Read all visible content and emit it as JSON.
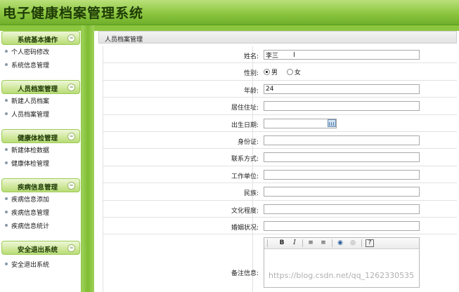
{
  "app": {
    "title": "电子健康档案管理系统"
  },
  "sidebar": {
    "sections": [
      {
        "title": "系统基本操作",
        "items": [
          "个人密码修改",
          "系统信息管理"
        ]
      },
      {
        "title": "人员档案管理",
        "items": [
          "新建人员档案",
          "人员档案管理"
        ]
      },
      {
        "title": "健康体检管理",
        "items": [
          "新建体检数据",
          "健康体检管理"
        ]
      },
      {
        "title": "疾病信息管理",
        "items": [
          "疾病信息添加",
          "疾病信息管理",
          "疾病信息统计"
        ]
      },
      {
        "title": "安全退出系统",
        "items": [
          "安全退出系统"
        ]
      }
    ],
    "collapse_glyph": "≈"
  },
  "main": {
    "panel_title": "人员档案管理",
    "form": {
      "name_label": "姓名:",
      "name_value": "李三",
      "gender_label": "性别:",
      "gender_male": "男",
      "gender_female": "女",
      "gender_selected": "男",
      "age_label": "年龄:",
      "age_value": "24",
      "address_label": "居住住址:",
      "address_value": "",
      "birth_label": "出生日期:",
      "birth_value": "",
      "id_label": "身份证:",
      "id_value": "",
      "contact_label": "联系方式:",
      "contact_value": "",
      "work_label": "工作单位:",
      "work_value": "",
      "ethnic_label": "民族:",
      "ethnic_value": "",
      "edu_label": "文化程度:",
      "edu_value": "",
      "marital_label": "婚姻状况:",
      "marital_value": "",
      "notes_label": "备注信息:"
    },
    "editor_toolbar": {
      "bold": "B",
      "italic": "I",
      "ordered_list": "≡",
      "unordered_list": "≡",
      "link": "◉",
      "unlink": "◎",
      "help": "?"
    }
  },
  "watermark": "https://blog.csdn.net/qq_1262330535",
  "colors": {
    "header_green": "#8cc63f",
    "dark_green_text": "#1d3a06"
  }
}
